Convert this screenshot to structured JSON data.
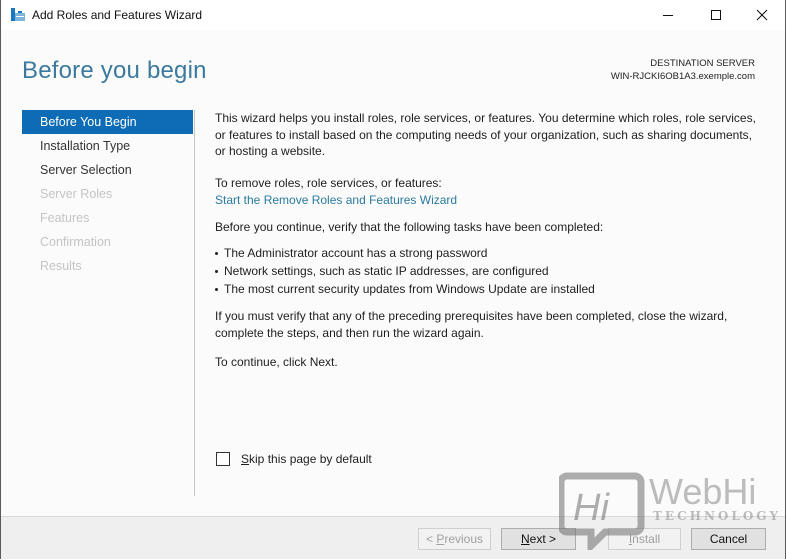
{
  "window": {
    "title": "Add Roles and Features Wizard",
    "controls": [
      "minimize",
      "maximize",
      "close"
    ]
  },
  "header": {
    "page_title": "Before you begin",
    "destination_label": "DESTINATION SERVER",
    "destination_server": "WIN-RJCKI6OB1A3.exemple.com"
  },
  "nav": {
    "items": [
      {
        "label": "Before You Begin",
        "state": "active"
      },
      {
        "label": "Installation Type",
        "state": "enabled"
      },
      {
        "label": "Server Selection",
        "state": "enabled"
      },
      {
        "label": "Server Roles",
        "state": "disabled"
      },
      {
        "label": "Features",
        "state": "disabled"
      },
      {
        "label": "Confirmation",
        "state": "disabled"
      },
      {
        "label": "Results",
        "state": "disabled"
      }
    ]
  },
  "main": {
    "intro": "This wizard helps you install roles, role services, or features. You determine which roles, role services, or features to install based on the computing needs of your organization, such as sharing documents, or hosting a website.",
    "remove_label": "To remove roles, role services, or features:",
    "remove_link": "Start the Remove Roles and Features Wizard",
    "verify_text": "Before you continue, verify that the following tasks have been completed:",
    "tasks": [
      "The Administrator account has a strong password",
      "Network settings, such as static IP addresses, are configured",
      "The most current security updates from Windows Update are installed"
    ],
    "if_you_must": "If you must verify that any of the preceding prerequisites have been completed, close the wizard, complete the steps, and then run the wizard again.",
    "continue_text": "To continue, click Next."
  },
  "skip_checkbox": {
    "label_accesskey": "S",
    "label_rest": "kip this page by default",
    "checked": false
  },
  "footer": {
    "previous": {
      "prefix": "< ",
      "accesskey": "P",
      "rest": "revious",
      "enabled": false
    },
    "next": {
      "accesskey": "N",
      "rest": "ext >",
      "enabled": true
    },
    "install": {
      "accesskey": "I",
      "rest": "nstall",
      "enabled": false
    },
    "cancel": {
      "label": "Cancel",
      "enabled": true
    }
  },
  "watermark": {
    "mark": "Hi",
    "brand": "WebHi",
    "tagline": "TECHNOLOGY"
  },
  "colors": {
    "accent": "#0e6cb6",
    "title": "#3b7a9e",
    "link": "#2b7aa0",
    "disabled_text": "#c4c4c4"
  }
}
